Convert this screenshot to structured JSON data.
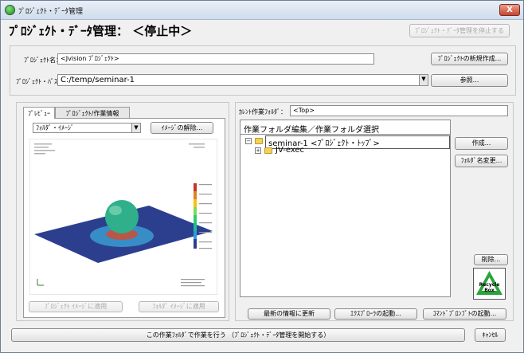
{
  "window": {
    "title": "ﾌﾟﾛｼﾞｪｸﾄ・ﾃﾞｰﾀ管理",
    "close": "X"
  },
  "heading": "ﾌﾟﾛｼﾞｪｸﾄ・ﾃﾞｰﾀ管理： ＜停止中＞",
  "buttons": {
    "stop_management": "ﾌﾟﾛｼﾞｪｸﾄ・ﾃﾞｰﾀ管理を停止する",
    "new_project": "ﾌﾟﾛｼﾞｪｸﾄの新規作成...",
    "browse": "参照...",
    "release_image": "ｲﾒｰｼﾞの解除...",
    "apply_project_image": "ﾌﾟﾛｼﾞｪｸﾄ ｲﾒｰｼﾞに適用",
    "apply_folder_image": "ﾌｫﾙﾀﾞ ｲﾒｰｼﾞに適用",
    "create": "作成...",
    "rename_folder": "ﾌｫﾙﾀﾞ名変更...",
    "delete": "削除...",
    "refresh": "最新の情報に更新",
    "start_explorer": "ｴｸｽﾌﾟﾛｰﾗの起動...",
    "start_command_prompt": "ｺﾏﾝﾄﾞﾌﾟﾛﾝﾌﾟﾄの起動...",
    "work_in_folder": "この作業ﾌｫﾙﾀﾞで作業を行う （ﾌﾟﾛｼﾞｪｸﾄ・ﾃﾞｰﾀ管理を開始する）",
    "cancel": "ｷｬﾝｾﾙ"
  },
  "project": {
    "name_label": "ﾌﾟﾛｼﾞｪｸﾄ名：",
    "name_value": "<Jvision ﾌﾟﾛｼﾞｪｸﾄ>",
    "path_label": "ﾌﾟﾛｼﾞｪｸﾄ・ﾊﾟｽ：",
    "path_value": "C:/temp/seminar-1"
  },
  "tabs": [
    {
      "label": "ﾌﾟﾚﾋﾞｭｰ",
      "active": true
    },
    {
      "label": "ﾌﾟﾛｼﾞｪｸﾄ/作業情報",
      "active": false
    }
  ],
  "preview": {
    "image_type": "ﾌｫﾙﾀﾞ・ｲﾒｰｼﾞ"
  },
  "current_folder": {
    "label": "ｶﾚﾝﾄ作業ﾌｫﾙﾀﾞ：",
    "value": "<Top>"
  },
  "tree": {
    "header": "作業フォルダ編集／作業フォルダ選択",
    "items": [
      {
        "label": "seminar-1 <ﾌﾟﾛｼﾞｪｸﾄ・ﾄｯﾌﾟ>",
        "expander": "−",
        "selected": true
      },
      {
        "label": "JV-exec",
        "expander": "+",
        "selected": false
      }
    ]
  },
  "recycle_box": {
    "line1": "Recycle",
    "line2": "Box"
  },
  "colors": {
    "window_bg": "#f0f0f0",
    "recycle_green": "#2aa33c",
    "sphere": "#2fb08a",
    "plate": "#2c3f8f"
  }
}
